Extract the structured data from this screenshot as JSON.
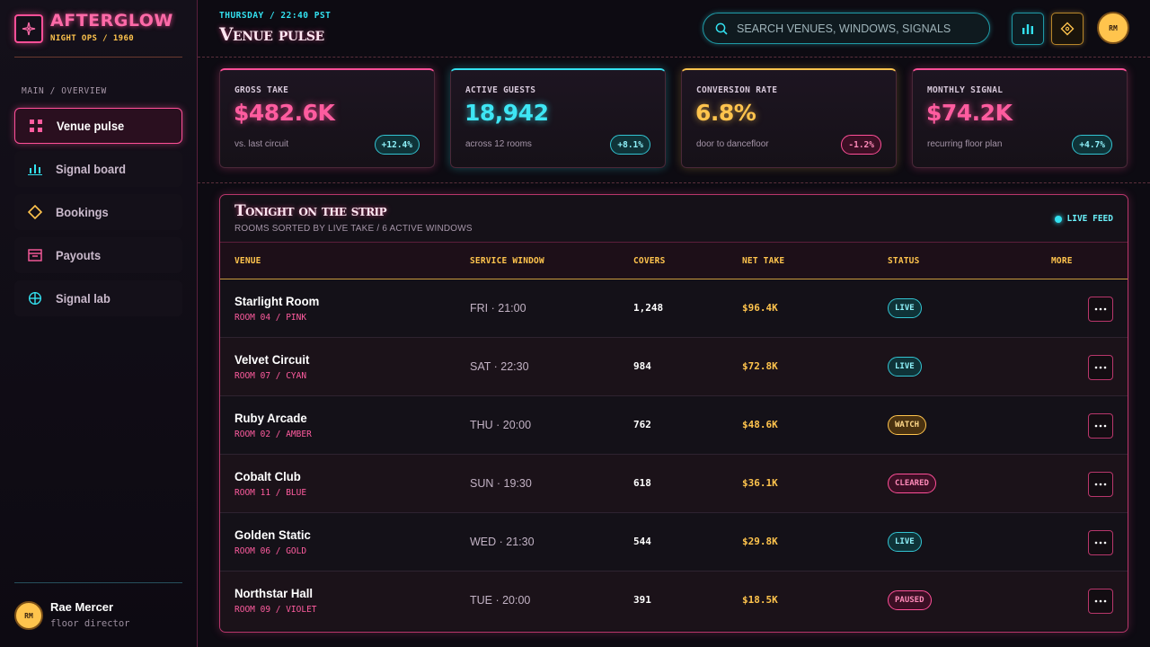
{
  "brand": {
    "title": "AFTERGLOW",
    "subtitle": "NIGHT OPS / 1960"
  },
  "sidebar": {
    "caption": "MAIN / OVERVIEW",
    "items": [
      {
        "label": "Venue pulse",
        "icon": "grid-icon",
        "active": true
      },
      {
        "label": "Signal board",
        "icon": "bar-chart-icon",
        "active": false
      },
      {
        "label": "Bookings",
        "icon": "diamond-icon",
        "active": false
      },
      {
        "label": "Payouts",
        "icon": "archive-icon",
        "active": false
      },
      {
        "label": "Signal lab",
        "icon": "crosshair-icon",
        "active": false
      }
    ],
    "user": {
      "initials": "RM",
      "name": "Rae Mercer",
      "role": "floor director"
    }
  },
  "topbar": {
    "eyebrow": "THURSDAY / 22:40 PST",
    "title": "Venue pulse",
    "search_placeholder": "SEARCH VENUES, WINDOWS, SIGNALS",
    "avatar_initials": "RM"
  },
  "kpis": [
    {
      "label": "GROSS TAKE",
      "value": "$482.6K",
      "note": "vs. last circuit",
      "delta": "+12.4%",
      "trend": "up",
      "accent": "#ff4f98"
    },
    {
      "label": "ACTIVE GUESTS",
      "value": "18,942",
      "note": "across 12 rooms",
      "delta": "+8.1%",
      "trend": "up",
      "accent": "#33e1f0"
    },
    {
      "label": "CONVERSION RATE",
      "value": "6.8%",
      "note": "door to dancefloor",
      "delta": "-1.2%",
      "trend": "down",
      "accent": "#ffc44d"
    },
    {
      "label": "MONTHLY SIGNAL",
      "value": "$74.2K",
      "note": "recurring floor plan",
      "delta": "+4.7%",
      "trend": "up",
      "accent": "#ff4f98"
    }
  ],
  "table": {
    "title": "Tonight on the strip",
    "subtitle": "ROOMS SORTED BY LIVE TAKE / 6 ACTIVE WINDOWS",
    "live_label": "LIVE FEED",
    "columns": [
      "VENUE",
      "SERVICE WINDOW",
      "COVERS",
      "NET TAKE",
      "STATUS",
      "MORE"
    ],
    "rows": [
      {
        "venue": "Starlight Room",
        "room": "ROOM 04 / PINK",
        "window": "FRI · 21:00",
        "covers": "1,248",
        "net": "$96.4K",
        "status": "LIVE"
      },
      {
        "venue": "Velvet Circuit",
        "room": "ROOM 07 / CYAN",
        "window": "SAT · 22:30",
        "covers": "984",
        "net": "$72.8K",
        "status": "LIVE"
      },
      {
        "venue": "Ruby Arcade",
        "room": "ROOM 02 / AMBER",
        "window": "THU · 20:00",
        "covers": "762",
        "net": "$48.6K",
        "status": "WATCH"
      },
      {
        "venue": "Cobalt Club",
        "room": "ROOM 11 / BLUE",
        "window": "SUN · 19:30",
        "covers": "618",
        "net": "$36.1K",
        "status": "CLEARED"
      },
      {
        "venue": "Golden Static",
        "room": "ROOM 06 / GOLD",
        "window": "WED · 21:30",
        "covers": "544",
        "net": "$29.8K",
        "status": "LIVE"
      },
      {
        "venue": "Northstar Hall",
        "room": "ROOM 09 / VIOLET",
        "window": "TUE · 20:00",
        "covers": "391",
        "net": "$18.5K",
        "status": "PAUSED"
      }
    ]
  },
  "colors": {
    "pink": "#ff4f98",
    "cyan": "#33e1f0",
    "gold": "#ffc44d",
    "bg": "#0d0b12"
  }
}
